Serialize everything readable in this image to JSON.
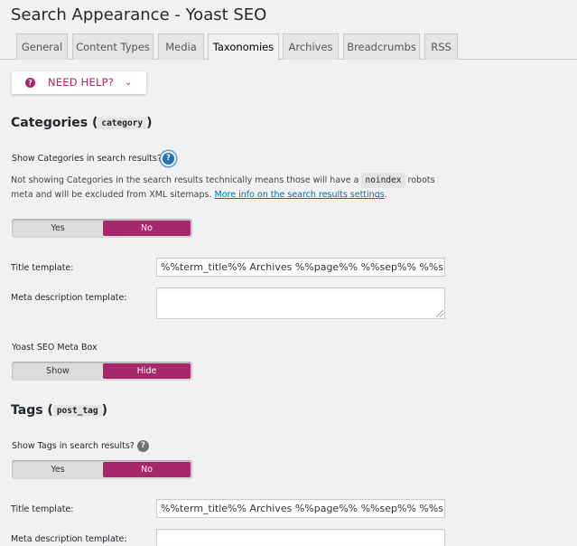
{
  "page": {
    "title": "Search Appearance - Yoast SEO"
  },
  "tabs": [
    {
      "label": "General"
    },
    {
      "label": "Content Types"
    },
    {
      "label": "Media"
    },
    {
      "label": "Taxonomies"
    },
    {
      "label": "Archives"
    },
    {
      "label": "Breadcrumbs"
    },
    {
      "label": "RSS"
    }
  ],
  "help": {
    "label": "NEED HELP?",
    "icon": "question-circle-icon"
  },
  "categories": {
    "title_prefix": "Categories (",
    "code": "category",
    "title_suffix": ")",
    "show_label": "Show ",
    "show_strong": "Categories",
    "show_suffix": " in search results?",
    "desc_part1": "Not showing Categories in the search results technically means those will have a ",
    "desc_code": "noindex",
    "desc_part2": " robots meta and will be excluded from XML sitemaps. ",
    "desc_link": "More info on the search results settings",
    "desc_end": ".",
    "toggle_yes": "Yes",
    "toggle_no": "No",
    "title_template_label": "Title template:",
    "title_template_value": "%%term_title%% Archives %%page%% %%sep%% %%sitename%%",
    "meta_desc_label": "Meta description template:",
    "metabox_label": "Yoast SEO Meta Box",
    "metabox_show": "Show",
    "metabox_hide": "Hide"
  },
  "tags": {
    "title_prefix": "Tags (",
    "code": "post_tag",
    "title_suffix": ")",
    "show_label": "Show ",
    "show_strong": "Tags",
    "show_suffix": " in search results?",
    "toggle_yes": "Yes",
    "toggle_no": "No",
    "title_template_label": "Title template:",
    "title_template_value": "%%term_title%% Archives %%page%% %%sep%% %%sitename%%",
    "meta_desc_label": "Meta description template:"
  },
  "colors": {
    "accent": "#a4286a",
    "link": "#0073aa",
    "focus": "#2271b1"
  }
}
